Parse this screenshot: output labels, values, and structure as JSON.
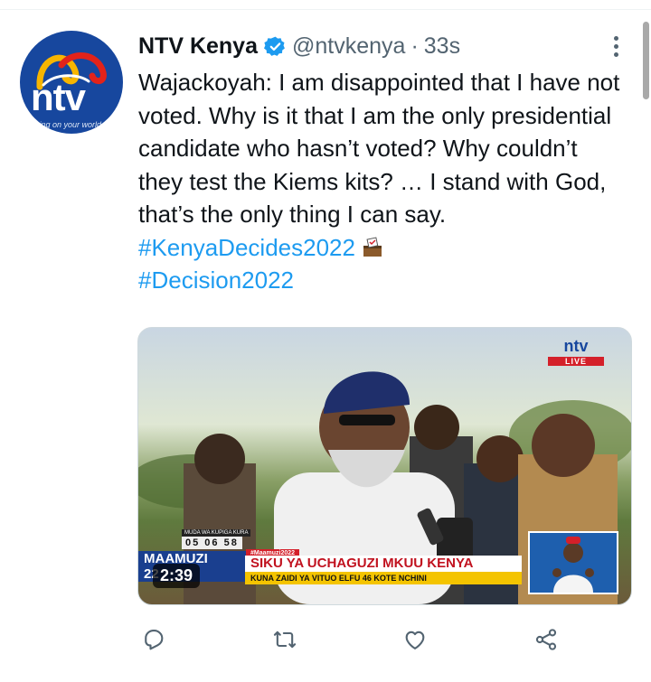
{
  "tweet": {
    "author_name": "NTV Kenya",
    "handle": "@ntvkenya",
    "separator": "·",
    "time": "33s",
    "avatar": {
      "logo_text": "ntv",
      "slogan": "turning on your world"
    },
    "text_main": "Wajackoyah: I am disappointed that I have not voted. Why is it that I am the only presidential candidate who hasn’t voted? Why couldn’t they test the Kiems kits? … I stand with God, that’s the only thing I can say. ",
    "hashtag1": "#KenyaDecides2022",
    "hashtag2": "#Decision2022",
    "icons": {
      "verified": "verified-badge-icon",
      "more": "more-icon",
      "emoji": "ballot-box-emoji"
    }
  },
  "media": {
    "duration": "2:39",
    "channel_logo": "ntv",
    "live_label": "LIVE",
    "countdown_label": "MUDA WA KUPIGA KURA",
    "countdown_value": "05 06 58",
    "show_label_line1": "MAAMUZI",
    "show_label_line2": "22",
    "show_tag": "#Maamuzi2022",
    "headline": "SIKU YA UCHAGUZI MKUU KENYA",
    "subheadline": "KUNA ZAIDI YA VITUO ELFU 46 KOTE NCHINI"
  },
  "actions": [
    {
      "name": "reply-icon"
    },
    {
      "name": "retweet-icon"
    },
    {
      "name": "like-icon"
    },
    {
      "name": "share-icon"
    }
  ],
  "colors": {
    "link": "#1d9bf0",
    "secondary_text": "#536471",
    "primary_text": "#0f1419",
    "ntv_blue": "#17479e",
    "ntv_red": "#d4202a"
  }
}
